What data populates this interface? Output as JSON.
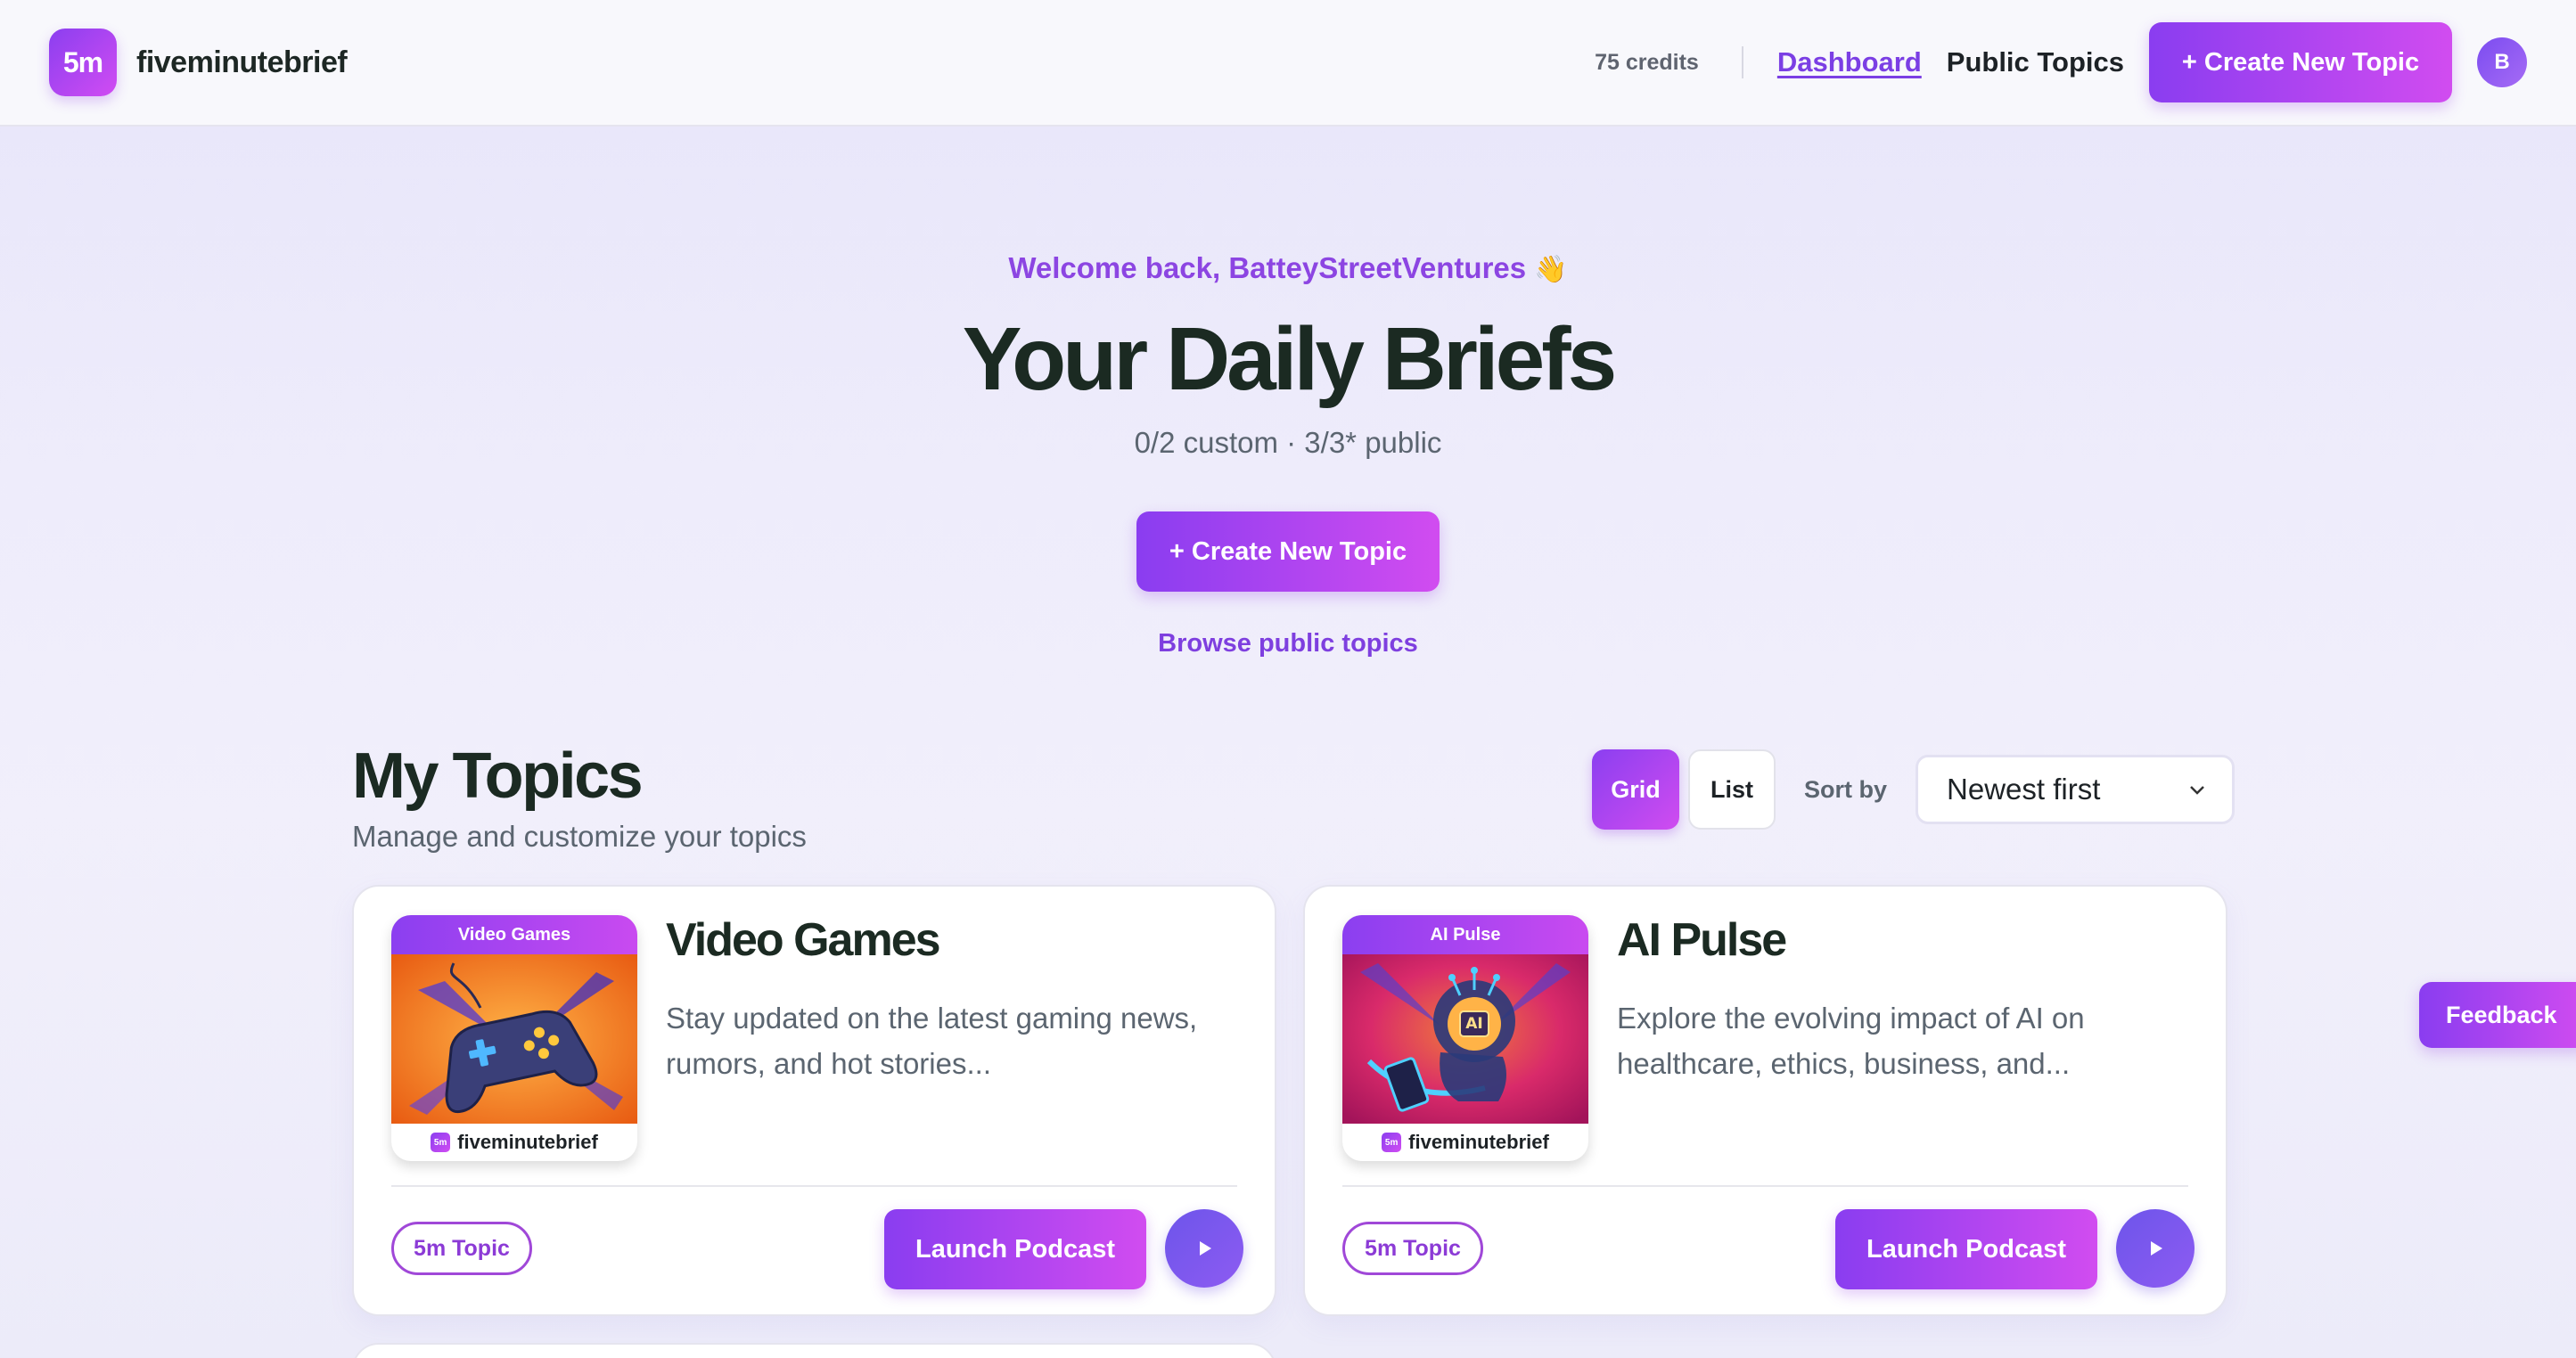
{
  "brand": {
    "badge": "5m",
    "name": "fiveminutebrief",
    "accent": "#8b3ff0",
    "accent_end": "#d14cf2"
  },
  "header": {
    "credits": "75 credits",
    "nav_dashboard": "Dashboard",
    "nav_public": "Public Topics",
    "create_label": "+ Create New Topic",
    "avatar_initial": "B"
  },
  "hero": {
    "welcome": "Welcome back, BatteyStreetVentures",
    "welcome_emoji": "👋",
    "title": "Your Daily Briefs",
    "subtitle": "0/2 custom · 3/3* public",
    "create_label": "+ Create New Topic",
    "browse_label": "Browse public topics"
  },
  "topics": {
    "title": "My Topics",
    "subtitle": "Manage and customize your topics",
    "view_grid": "Grid",
    "view_list": "List",
    "sort_label": "Sort by",
    "sort_value": "Newest first"
  },
  "cards": [
    {
      "thumb_label": "Video Games",
      "thumb_icon": "gamepad-icon",
      "thumb_footer": "fiveminutebrief",
      "thumb_badge": "5m",
      "title": "Video Games",
      "description": "Stay updated on the latest gaming news, rumors, and hot stories...",
      "tag": "5m Topic",
      "launch_label": "Launch Podcast"
    },
    {
      "thumb_label": "AI Pulse",
      "thumb_icon": "ai-head-icon",
      "thumb_footer": "fiveminutebrief",
      "thumb_badge": "5m",
      "thumb_art_text": "AI",
      "title": "AI Pulse",
      "description": "Explore the evolving impact of AI on healthcare, ethics, business, and...",
      "tag": "5m Topic",
      "launch_label": "Launch Podcast"
    }
  ],
  "feedback_label": "Feedback"
}
